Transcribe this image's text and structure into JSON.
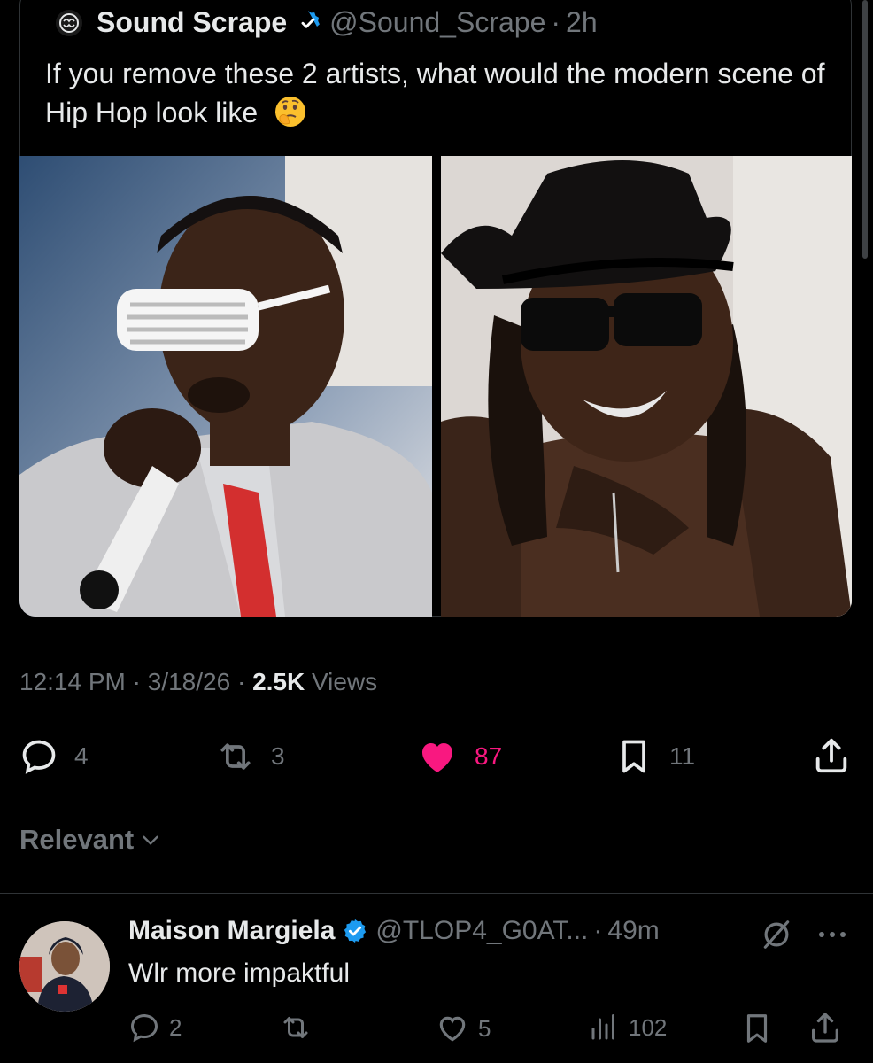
{
  "quoted": {
    "display_name": "Sound Scrape",
    "handle": "@Sound_Scrape",
    "sep": "·",
    "time": "2h",
    "text": "If you remove these 2 artists, what would the modern scene of Hip Hop look like"
  },
  "meta": {
    "time": "12:14 PM",
    "date": "3/18/26",
    "views_count": "2.5K",
    "views_label": "Views"
  },
  "actions": {
    "replies": "4",
    "reposts": "3",
    "likes": "87",
    "bookmarks": "11"
  },
  "sort": {
    "label": "Relevant"
  },
  "reply": {
    "display_name": "Maison Margiela",
    "handle": "@TLOP4_G0AT...",
    "sep": "·",
    "time": "49m",
    "text": "Wlr more impaktful",
    "replies": "2",
    "likes": "5",
    "views": "102"
  },
  "colors": {
    "background": "#000000",
    "text": "#e7e9ea",
    "muted": "#71767b",
    "verified": "#1d9bf0",
    "like_active": "#f91880"
  }
}
